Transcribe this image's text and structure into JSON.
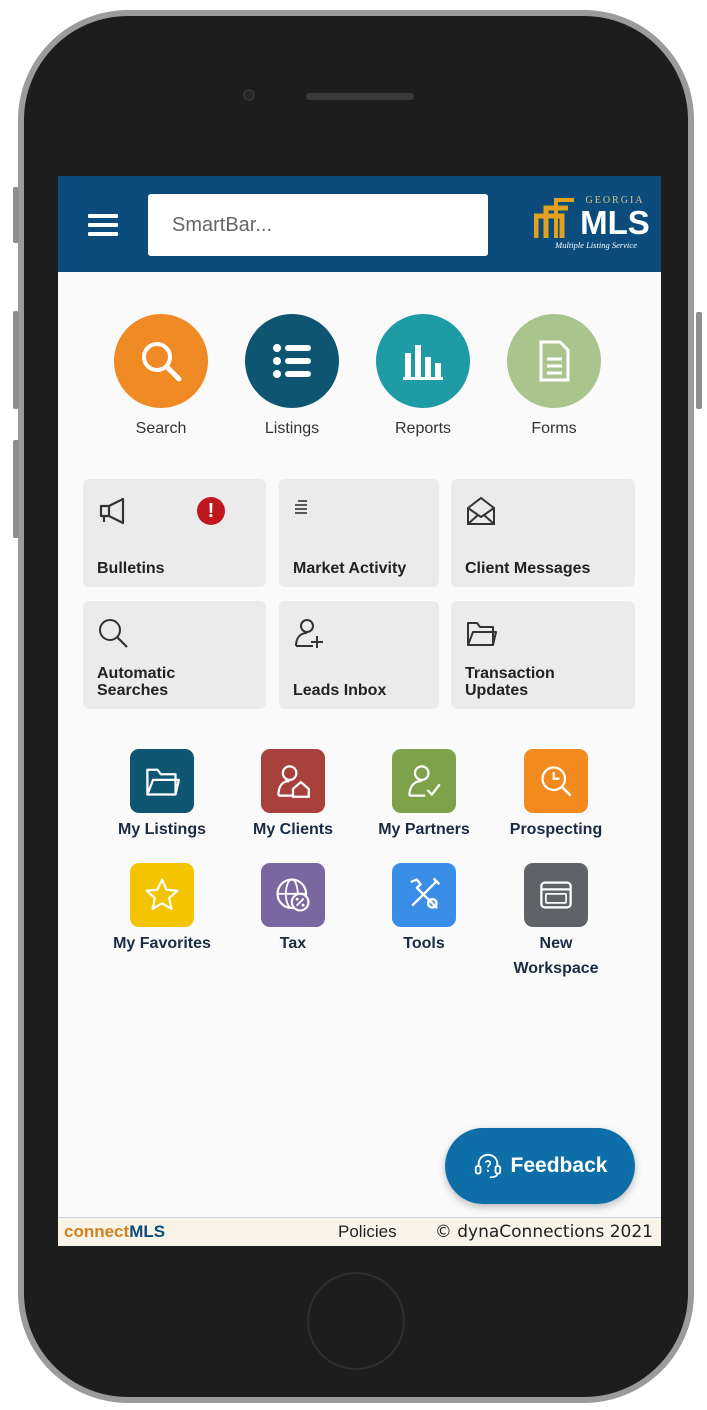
{
  "header": {
    "search_placeholder": "SmartBar...",
    "logo": {
      "top": "GEORGIA",
      "main": "MLS",
      "tagline": "Multiple Listing Service"
    }
  },
  "quick_actions": [
    {
      "label": "Search",
      "icon": "magnifier-icon",
      "color": "#f08a24"
    },
    {
      "label": "Listings",
      "icon": "list-icon",
      "color": "#0d5571"
    },
    {
      "label": "Reports",
      "icon": "bar-chart-icon",
      "color": "#1f9ba6"
    },
    {
      "label": "Forms",
      "icon": "document-icon",
      "color": "#a9c48d"
    }
  ],
  "tiles": [
    {
      "label": "Bulletins",
      "icon": "megaphone-icon",
      "badge": "!"
    },
    {
      "label": "Market Activity",
      "icon": "lines-icon"
    },
    {
      "label": "Client Messages",
      "icon": "envelope-open-icon"
    },
    {
      "label": "Automatic Searches",
      "line1": "Automatic",
      "line2": "Searches",
      "icon": "search-outline-icon"
    },
    {
      "label": "Leads Inbox",
      "icon": "user-add-icon"
    },
    {
      "label": "Transaction Updates",
      "line1": "Transaction",
      "line2": "Updates",
      "icon": "folder-outline-icon"
    }
  ],
  "apps": [
    {
      "label": "My Listings",
      "icon": "folder-icon",
      "color": "#0d5571"
    },
    {
      "label": "My Clients",
      "icon": "user-home-icon",
      "color": "#a8403c"
    },
    {
      "label": "My Partners",
      "icon": "user-check-icon",
      "color": "#7ea24a"
    },
    {
      "label": "Prospecting",
      "icon": "clock-search-icon",
      "color": "#f28a1e"
    },
    {
      "label": "My Favorites",
      "icon": "star-icon",
      "color": "#f5c400"
    },
    {
      "label": "Tax",
      "icon": "globe-percent-icon",
      "color": "#7b67a0"
    },
    {
      "label": "Tools",
      "icon": "tools-icon",
      "color": "#3b8ee8"
    },
    {
      "label": "New Workspace",
      "line1": "New",
      "line2": "Workspace",
      "icon": "window-icon",
      "color": "#5f6367"
    }
  ],
  "feedback": {
    "label": "Feedback"
  },
  "footer": {
    "brand_prefix": "connect",
    "brand_suffix": "MLS",
    "policies": "Policies",
    "copyright": "© dynaConnections 2021"
  },
  "colors": {
    "header": "#0c4c7d",
    "feedback": "#0e6fa8",
    "alert": "#c0171f",
    "logo_gold": "#e2a21f"
  }
}
